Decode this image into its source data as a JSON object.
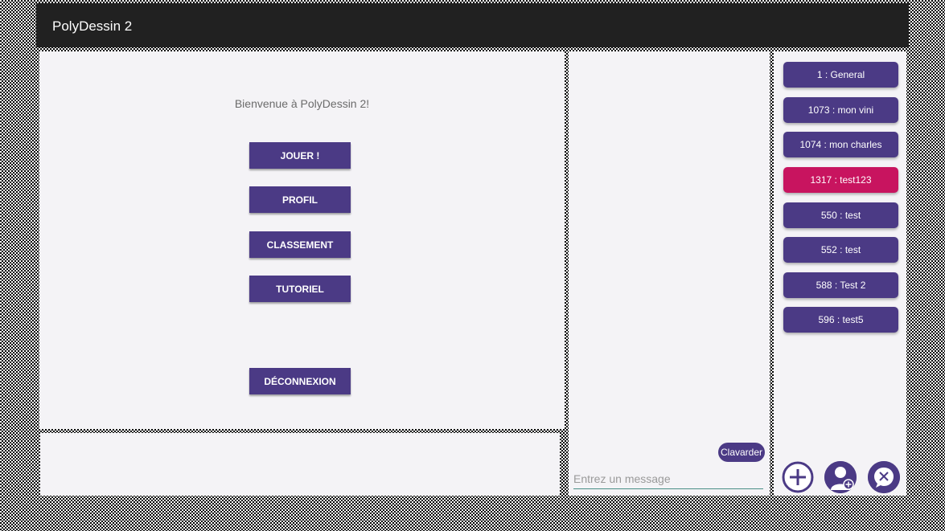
{
  "app": {
    "title": "PolyDessin 2"
  },
  "home": {
    "welcome": "Bienvenue à PolyDessin 2!",
    "buttons": {
      "play": "JOUER !",
      "profile": "PROFIL",
      "ranking": "CLASSEMENT",
      "tutorial": "TUTORIEL",
      "logout": "DÉCONNEXION"
    }
  },
  "chat": {
    "send_label": "Clavarder",
    "input_placeholder": "Entrez un message",
    "input_value": ""
  },
  "channels": {
    "items": [
      {
        "label": "1 : General"
      },
      {
        "label": "1073 : mon vini"
      },
      {
        "label": "1074 : mon charles"
      },
      {
        "label": "1317 : test123"
      },
      {
        "label": "550 : test"
      },
      {
        "label": "552 : test"
      },
      {
        "label": "588 : Test 2"
      },
      {
        "label": "596 : test5"
      }
    ],
    "active_index": 3,
    "actions": [
      "add-channel-icon",
      "add-user-icon",
      "leave-channel-icon"
    ]
  },
  "colors": {
    "primary": "#4b3a85",
    "accent": "#c8145f",
    "titlebar": "#212121",
    "panel": "#f4f3f6"
  }
}
